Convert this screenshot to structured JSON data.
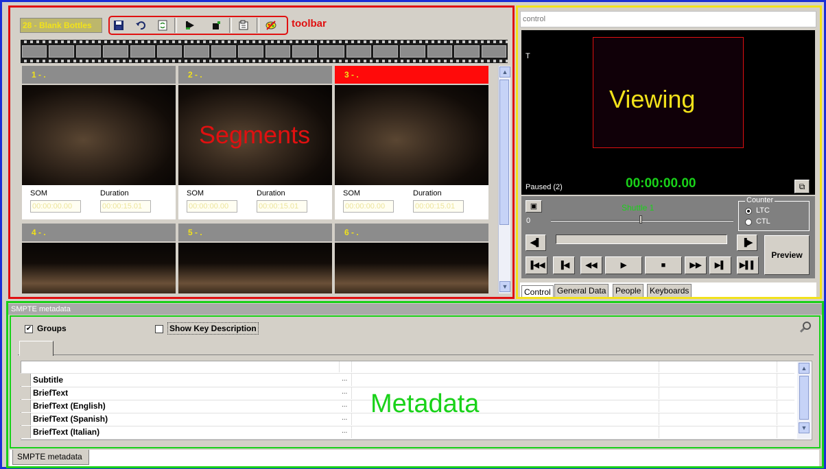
{
  "segments_panel": {
    "project_title": "28 - Blank Bottles",
    "toolbar_label": "toolbar",
    "toolbar_icons": [
      "save-icon",
      "undo-icon",
      "refresh-icon",
      "play-flag-icon",
      "stop-flag-icon",
      "properties-icon",
      "paint-icon"
    ],
    "watermark": "Segments",
    "som_label": "SOM",
    "duration_label": "Duration",
    "segments": [
      {
        "label": "1 - .",
        "som": "00:00:00.00",
        "duration": "00:00:15.01",
        "selected": false
      },
      {
        "label": "2 - .",
        "som": "00:00:00.00",
        "duration": "00:00:15.01",
        "selected": false
      },
      {
        "label": "3 - .",
        "som": "00:00:00.00",
        "duration": "00:00:15.01",
        "selected": true
      },
      {
        "label": "4 - .",
        "selected": false
      },
      {
        "label": "5 - .",
        "selected": false
      },
      {
        "label": "6 - .",
        "selected": false
      }
    ]
  },
  "viewer": {
    "control_field_placeholder": "control",
    "t_label": "T",
    "watermark": "Viewing",
    "timecode": "00:00:00.00",
    "status": "Paused (2)",
    "shuttle_label": "Shuttle 1",
    "shuttle_position_label": "0",
    "counter_title": "Counter",
    "counter_options": [
      "LTC",
      "CTL"
    ],
    "counter_selected": "LTC",
    "preview_label": "Preview",
    "transport_glyphs": {
      "step_back": "◀▌",
      "step_forward": "▐▶",
      "go_start": "▐◀◀",
      "prev": "▐◀",
      "rewind": "◀◀",
      "play": "▶",
      "stop": "■",
      "fast_forward": "▶▶",
      "next": "▶▌",
      "play_pause": "▶▌▌"
    },
    "tabs": [
      "Control",
      "General Data",
      "People",
      "Keyboards"
    ],
    "active_tab": "Control"
  },
  "metadata": {
    "title": "SMPTE metadata",
    "groups_label": "Groups",
    "groups_checked": true,
    "show_key_label": "Show Key Description",
    "show_key_checked": false,
    "rows": [
      "Subtitle",
      "BriefText",
      "BriefText (English)",
      "BriefText (Spanish)",
      "BriefText (Italian)"
    ],
    "row_button": "...",
    "watermark": "Metadata",
    "bottom_tab": "SMPTE metadata"
  }
}
